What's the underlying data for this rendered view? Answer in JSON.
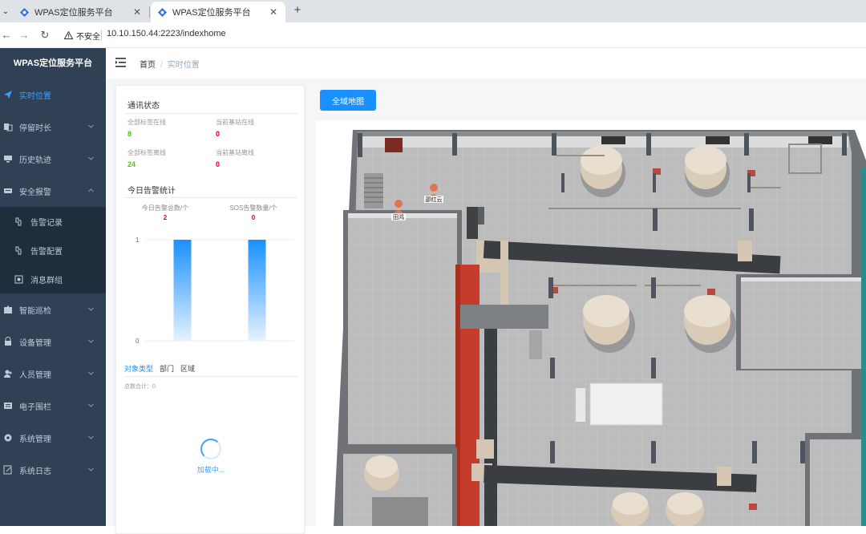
{
  "browser": {
    "tabs": [
      {
        "title": "WPAS定位服务平台",
        "active": false
      },
      {
        "title": "WPAS定位服务平台",
        "active": true
      }
    ],
    "security_label": "不安全",
    "url": "10.10.150.44:2223/indexhome"
  },
  "sidebar": {
    "logo": "WPAS定位服务平台",
    "items": [
      {
        "label": "实时位置",
        "icon": "send-icon",
        "active": true
      },
      {
        "label": "停留时长",
        "icon": "copy-icon",
        "expandable": true
      },
      {
        "label": "历史轨迹",
        "icon": "monitor-icon",
        "expandable": true
      },
      {
        "label": "安全报警",
        "icon": "keyboard-icon",
        "expandable": true,
        "expanded": true
      }
    ],
    "sub_items": [
      {
        "label": "告警记录",
        "icon": "tool-icon"
      },
      {
        "label": "告警配置",
        "icon": "tool-icon"
      },
      {
        "label": "消息群组",
        "icon": "box-icon"
      }
    ],
    "items_after": [
      {
        "label": "智能巡检",
        "icon": "puzzle-icon"
      },
      {
        "label": "设备管理",
        "icon": "lock-icon"
      },
      {
        "label": "人员管理",
        "icon": "user-icon"
      },
      {
        "label": "电子围栏",
        "icon": "fence-icon"
      },
      {
        "label": "系统管理",
        "icon": "gear-icon"
      },
      {
        "label": "系统日志",
        "icon": "edit-icon"
      }
    ]
  },
  "header": {
    "breadcrumb": {
      "home": "首页",
      "current": "实时位置"
    }
  },
  "panel": {
    "comm_title": "通讯状态",
    "stats": [
      {
        "label": "全部标签在线",
        "value": "8",
        "color": "#52c41a"
      },
      {
        "label": "当前基站在线",
        "value": "0",
        "color": "#d9001b"
      },
      {
        "label": "全部标签离线",
        "value": "24",
        "color": "#52c41a"
      },
      {
        "label": "当前基站离线",
        "value": "0",
        "color": "#d9001b"
      }
    ],
    "alarm_title": "今日告警统计",
    "alarm_stats": [
      {
        "label": "今日告警总数/个",
        "value": "2"
      },
      {
        "label": "SOS告警数量/个",
        "value": "0"
      }
    ],
    "tabs": [
      "对象类型",
      "部门",
      "区域"
    ],
    "total": "总数合计：0",
    "loading": "加载中..."
  },
  "chart_data": {
    "type": "bar",
    "categories": [
      "",
      ""
    ],
    "values": [
      1,
      1
    ],
    "yticks": [
      "0",
      "1"
    ],
    "ylim": [
      0,
      1
    ],
    "bar_color_top": "#1890ff",
    "bar_color_bottom": "#e6f2ff"
  },
  "main": {
    "full_map_button": "全域地图",
    "map_people": [
      {
        "name": "田鸿"
      },
      {
        "name": "邵红云"
      }
    ]
  }
}
